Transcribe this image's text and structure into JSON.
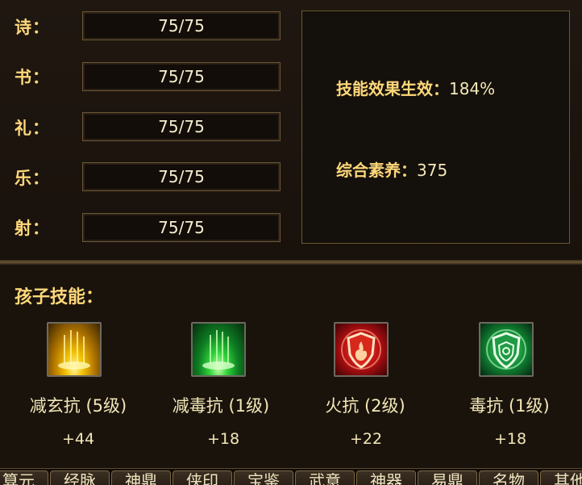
{
  "stats": [
    {
      "label": "诗：",
      "value": "75/75"
    },
    {
      "label": "书：",
      "value": "75/75"
    },
    {
      "label": "礼：",
      "value": "75/75"
    },
    {
      "label": "乐：",
      "value": "75/75"
    },
    {
      "label": "射：",
      "value": "75/75"
    }
  ],
  "summary": {
    "effect_label": "技能效果生效：",
    "effect_value": "184%",
    "score_label": "综合素养：",
    "score_value": "375"
  },
  "skills_title": "孩子技能：",
  "skills": [
    {
      "name": "减玄抗 (5级)",
      "bonus": "+44",
      "icon": "golden-light-icon"
    },
    {
      "name": "减毒抗 (1级)",
      "bonus": "+18",
      "icon": "green-light-icon"
    },
    {
      "name": "火抗 (2级)",
      "bonus": "+22",
      "icon": "fire-shield-icon"
    },
    {
      "name": "毒抗 (1级)",
      "bonus": "+18",
      "icon": "poison-shield-icon"
    }
  ],
  "tabs": [
    "算元",
    "经脉",
    "神鼎",
    "侠印",
    "宝鉴",
    "武意",
    "神器",
    "易鼎",
    "名物",
    "其他"
  ]
}
